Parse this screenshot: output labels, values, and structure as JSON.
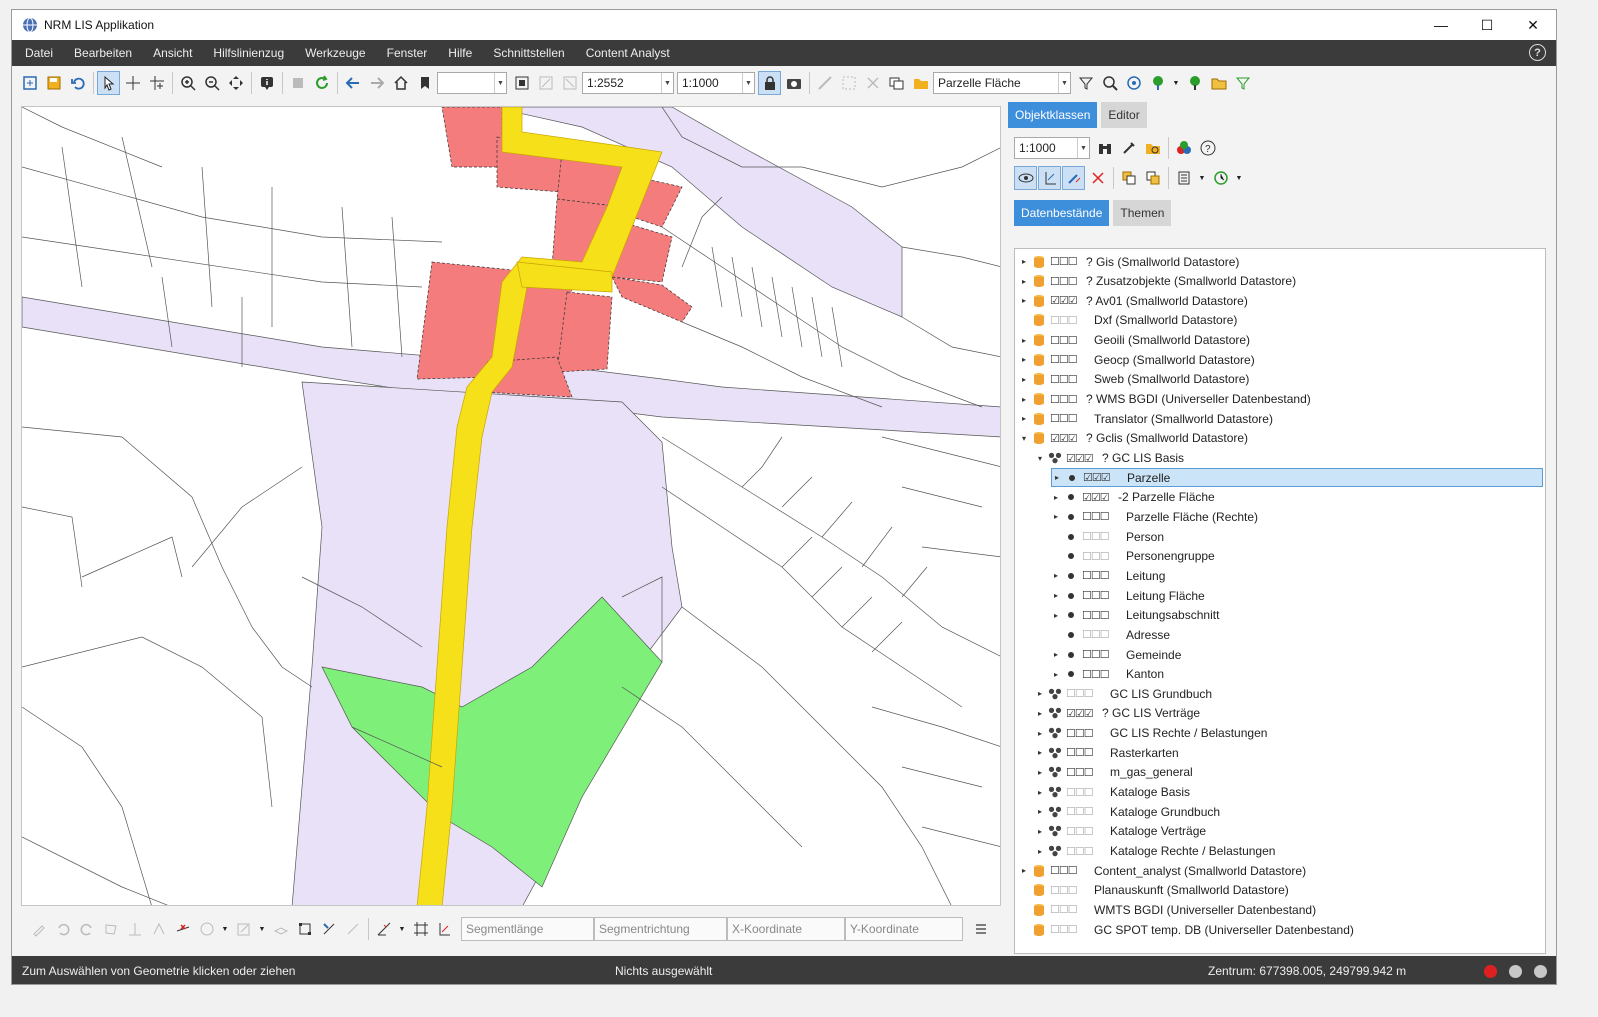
{
  "window": {
    "title": "NRM LIS Applikation"
  },
  "menu": [
    "Datei",
    "Bearbeiten",
    "Ansicht",
    "Hilfslinienzug",
    "Werkzeuge",
    "Fenster",
    "Hilfe",
    "Schnittstellen",
    "Content Analyst"
  ],
  "toolbar": {
    "scale_value": "1:2552",
    "scale_select": "1:1000",
    "layer_select": "Parzelle Fläche"
  },
  "edit_fields": [
    "Segmentlänge",
    "Segmentrichtung",
    "X-Koordinate",
    "Y-Koordinate"
  ],
  "right_panel": {
    "tabs": [
      "Objektklassen",
      "Editor"
    ],
    "scale": "1:1000",
    "subtabs": [
      "Datenbestände",
      "Themen"
    ],
    "tree": [
      {
        "label": "? Gis (Smallworld Datastore)",
        "level": 0,
        "icon": "db",
        "cb": "☐☐☐",
        "exp": "▸"
      },
      {
        "label": "? Zusatzobjekte (Smallworld Datastore)",
        "level": 0,
        "icon": "db",
        "cb": "☐☐☐",
        "exp": "▸"
      },
      {
        "label": "? Av01 (Smallworld Datastore)",
        "level": 0,
        "icon": "db",
        "cb": "☑☑☑",
        "exp": "▸"
      },
      {
        "label": "Dxf (Smallworld Datastore)",
        "level": 0,
        "icon": "db",
        "cb": "☐☐☐",
        "dim": true,
        "exp": ""
      },
      {
        "label": "Geoili (Smallworld Datastore)",
        "level": 0,
        "icon": "db",
        "cb": "☐☐☐",
        "exp": "▸"
      },
      {
        "label": "Geocp (Smallworld Datastore)",
        "level": 0,
        "icon": "db",
        "cb": "☐☐☐",
        "exp": "▸"
      },
      {
        "label": "Sweb (Smallworld Datastore)",
        "level": 0,
        "icon": "db",
        "cb": "☐☐☐",
        "exp": "▸"
      },
      {
        "label": "? WMS BGDI (Universeller Datenbestand)",
        "level": 0,
        "icon": "db",
        "cb": "☐☐☐",
        "exp": "▸"
      },
      {
        "label": "Translator (Smallworld Datastore)",
        "level": 0,
        "icon": "db",
        "cb": "☐☐☐",
        "exp": "▸"
      },
      {
        "label": "? Gclis (Smallworld Datastore)",
        "level": 0,
        "icon": "db",
        "cb": "☑☑☑",
        "exp": "▾"
      },
      {
        "label": "? GC LIS Basis",
        "level": 1,
        "icon": "grp",
        "cb": "☑☑☑",
        "exp": "▾"
      },
      {
        "label": "Parzelle",
        "level": 2,
        "icon": "dot",
        "cb": "☑☑☑",
        "exp": "▸",
        "hl": true
      },
      {
        "label": "-2 Parzelle Fläche",
        "level": 2,
        "icon": "dot",
        "cb": "☑☑☑",
        "exp": "▸"
      },
      {
        "label": "Parzelle Fläche (Rechte)",
        "level": 2,
        "icon": "dot",
        "cb": "☐☐☐",
        "exp": "▸"
      },
      {
        "label": "Person",
        "level": 2,
        "icon": "dot",
        "cb": "☐☐☐",
        "dim": true,
        "exp": ""
      },
      {
        "label": "Personengruppe",
        "level": 2,
        "icon": "dot",
        "cb": "☐☐☐",
        "dim": true,
        "exp": ""
      },
      {
        "label": "Leitung",
        "level": 2,
        "icon": "dot",
        "cb": "☐☐☐",
        "exp": "▸"
      },
      {
        "label": "Leitung Fläche",
        "level": 2,
        "icon": "dot",
        "cb": "☐☐☐",
        "exp": "▸"
      },
      {
        "label": "Leitungsabschnitt",
        "level": 2,
        "icon": "dot",
        "cb": "☐☐☐",
        "exp": "▸"
      },
      {
        "label": "Adresse",
        "level": 2,
        "icon": "dot",
        "cb": "☐☐☐",
        "dim": true,
        "exp": ""
      },
      {
        "label": "Gemeinde",
        "level": 2,
        "icon": "dot",
        "cb": "☐☐☐",
        "exp": "▸"
      },
      {
        "label": "Kanton",
        "level": 2,
        "icon": "dot",
        "cb": "☐☐☐",
        "exp": "▸"
      },
      {
        "label": "GC LIS Grundbuch",
        "level": 1,
        "icon": "grp",
        "cb": "☐☐☐",
        "dim": true,
        "exp": "▸"
      },
      {
        "label": "? GC LIS Verträge",
        "level": 1,
        "icon": "grp",
        "cb": "☑☑☑",
        "exp": "▸"
      },
      {
        "label": "GC LIS Rechte / Belastungen",
        "level": 1,
        "icon": "grp",
        "cb": "☐☐☐",
        "exp": "▸"
      },
      {
        "label": "Rasterkarten",
        "level": 1,
        "icon": "grp",
        "cb": "☐☐☐",
        "exp": "▸"
      },
      {
        "label": "m_gas_general",
        "level": 1,
        "icon": "grp",
        "cb": "☐☐☐",
        "exp": "▸"
      },
      {
        "label": "Kataloge Basis",
        "level": 1,
        "icon": "grp",
        "cb": "☐☐☐",
        "dim": true,
        "exp": "▸"
      },
      {
        "label": "Kataloge Grundbuch",
        "level": 1,
        "icon": "grp",
        "cb": "☐☐☐",
        "dim": true,
        "exp": "▸"
      },
      {
        "label": "Kataloge Verträge",
        "level": 1,
        "icon": "grp",
        "cb": "☐☐☐",
        "dim": true,
        "exp": "▸"
      },
      {
        "label": "Kataloge Rechte / Belastungen",
        "level": 1,
        "icon": "grp",
        "cb": "☐☐☐",
        "dim": true,
        "exp": "▸"
      },
      {
        "label": "Content_analyst (Smallworld Datastore)",
        "level": 0,
        "icon": "db",
        "cb": "☐☐☐",
        "exp": "▸"
      },
      {
        "label": "Planauskunft (Smallworld Datastore)",
        "level": 0,
        "icon": "db",
        "cb": "☐☐☐",
        "dim": true,
        "exp": ""
      },
      {
        "label": "WMTS BGDI (Universeller Datenbestand)",
        "level": 0,
        "icon": "db",
        "cb": "☐☐☐",
        "dim": true,
        "exp": ""
      },
      {
        "label": "GC SPOT temp. DB (Universeller Datenbestand)",
        "level": 0,
        "icon": "db",
        "cb": "☐☐☐",
        "dim": true,
        "exp": ""
      }
    ]
  },
  "status": {
    "hint": "Zum Auswählen von Geometrie klicken oder ziehen",
    "selection": "Nichts ausgewählt",
    "center": "Zentrum: 677398.005, 249799.942 m"
  },
  "colors": {
    "accent": "#3d8edb",
    "parcel_red": "#f47c7c",
    "road_yellow": "#f6e01a",
    "zone_purple": "#e8e1f7",
    "zone_green": "#7ef07a",
    "db_orange": "#f0a030"
  }
}
